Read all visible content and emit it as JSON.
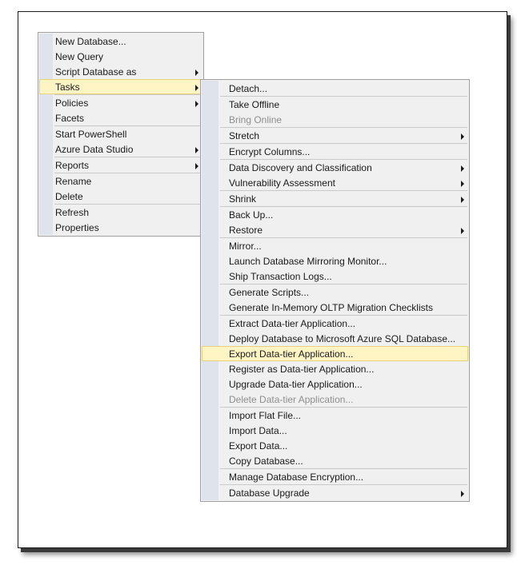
{
  "main_menu": {
    "groups": [
      [
        {
          "label": "New Database...",
          "submenu": false
        },
        {
          "label": "New Query",
          "submenu": false
        },
        {
          "label": "Script Database as",
          "submenu": true
        },
        {
          "label": "Tasks",
          "submenu": true,
          "highlighted": true
        }
      ],
      [
        {
          "label": "Policies",
          "submenu": true
        },
        {
          "label": "Facets",
          "submenu": false
        }
      ],
      [
        {
          "label": "Start PowerShell",
          "submenu": false
        },
        {
          "label": "Azure Data Studio",
          "submenu": true
        }
      ],
      [
        {
          "label": "Reports",
          "submenu": true
        }
      ],
      [
        {
          "label": "Rename",
          "submenu": false
        },
        {
          "label": "Delete",
          "submenu": false
        }
      ],
      [
        {
          "label": "Refresh",
          "submenu": false
        },
        {
          "label": "Properties",
          "submenu": false
        }
      ]
    ]
  },
  "tasks_menu": {
    "groups": [
      [
        {
          "label": "Detach...",
          "submenu": false
        }
      ],
      [
        {
          "label": "Take Offline",
          "submenu": false
        },
        {
          "label": "Bring Online",
          "submenu": false,
          "disabled": true
        }
      ],
      [
        {
          "label": "Stretch",
          "submenu": true
        }
      ],
      [
        {
          "label": "Encrypt Columns...",
          "submenu": false
        }
      ],
      [
        {
          "label": "Data Discovery and Classification",
          "submenu": true
        },
        {
          "label": "Vulnerability Assessment",
          "submenu": true
        }
      ],
      [
        {
          "label": "Shrink",
          "submenu": true
        }
      ],
      [
        {
          "label": "Back Up...",
          "submenu": false
        },
        {
          "label": "Restore",
          "submenu": true
        }
      ],
      [
        {
          "label": "Mirror...",
          "submenu": false
        },
        {
          "label": "Launch Database Mirroring Monitor...",
          "submenu": false
        },
        {
          "label": "Ship Transaction Logs...",
          "submenu": false
        }
      ],
      [
        {
          "label": "Generate Scripts...",
          "submenu": false
        },
        {
          "label": "Generate In-Memory OLTP Migration Checklists",
          "submenu": false
        }
      ],
      [
        {
          "label": "Extract Data-tier Application...",
          "submenu": false
        },
        {
          "label": "Deploy Database to Microsoft Azure SQL Database...",
          "submenu": false
        },
        {
          "label": "Export Data-tier Application...",
          "submenu": false,
          "highlighted": true
        },
        {
          "label": "Register as Data-tier Application...",
          "submenu": false
        },
        {
          "label": "Upgrade Data-tier Application...",
          "submenu": false
        },
        {
          "label": "Delete Data-tier Application...",
          "submenu": false,
          "disabled": true
        }
      ],
      [
        {
          "label": "Import Flat File...",
          "submenu": false
        },
        {
          "label": "Import Data...",
          "submenu": false
        },
        {
          "label": "Export Data...",
          "submenu": false
        },
        {
          "label": "Copy Database...",
          "submenu": false
        }
      ],
      [
        {
          "label": "Manage Database Encryption...",
          "submenu": false
        }
      ],
      [
        {
          "label": "Database Upgrade",
          "submenu": true
        }
      ]
    ]
  },
  "colors": {
    "menu_background": "#f0f0f0",
    "gutter": "#dfe4ec",
    "highlight": "#fff4c4",
    "highlight_border": "#e6d27a",
    "disabled_text": "#8e8e8e"
  }
}
